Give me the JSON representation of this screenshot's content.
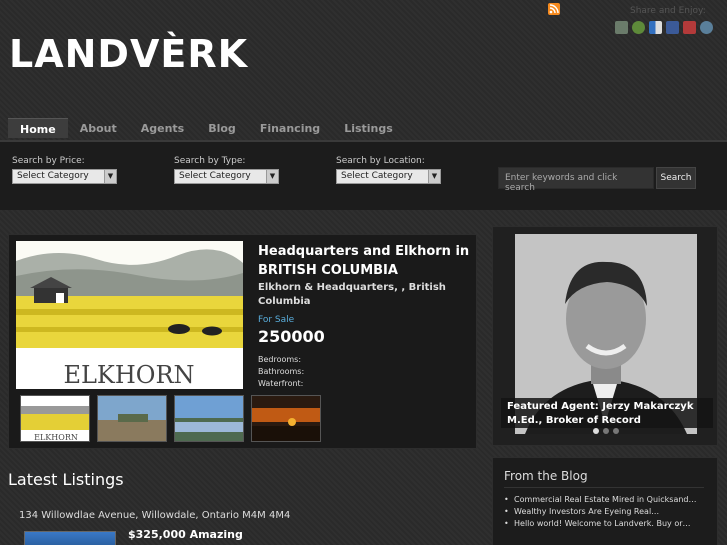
{
  "header": {
    "logo_text": "LANDVÈRK",
    "share_label": "Share and Enjoy:",
    "social_icons": [
      "digg-icon",
      "delicious-icon",
      "stumbleupon-icon",
      "facebook-icon",
      "mixx-icon",
      "google-icon"
    ],
    "rss_icon": "rss-icon"
  },
  "nav": {
    "items": [
      {
        "label": "Home",
        "active": true
      },
      {
        "label": "About"
      },
      {
        "label": "Agents"
      },
      {
        "label": "Blog"
      },
      {
        "label": "Financing"
      },
      {
        "label": "Listings"
      }
    ]
  },
  "search": {
    "price_label": "Search by Price:",
    "type_label": "Search by Type:",
    "location_label": "Search by Location:",
    "price_value": "Select Category",
    "type_value": "Select Category",
    "location_value": "Select Category",
    "keyword_placeholder": "Enter keywords and click search",
    "button_label": "Search"
  },
  "featured": {
    "title": "Headquarters and Elkhorn in BRITISH COLUMBIA",
    "address": "Elkhorn & Headquarters, , British Columbia",
    "status": "For Sale",
    "price": "250000",
    "bedrooms": "Bedrooms:",
    "bathrooms": "Bathrooms:",
    "waterfront": "Waterfront:",
    "image_caption": "ELKHORN",
    "thumb_caption": "ELKHORN"
  },
  "agent": {
    "caption_line1": "Featured Agent: Jerzy Makarczyk",
    "caption_line2": "M.Ed., Broker of Record"
  },
  "latest": {
    "heading": "Latest Listings",
    "items": [
      {
        "address": "134 Willowdlae Avenue, Willowdale, Ontario M4M 4M4",
        "price": "$325,000 Amazing"
      }
    ]
  },
  "blog": {
    "heading": "From the Blog",
    "posts": [
      "Commercial Real Estate Mired in Quicksand…",
      "Wealthy Investors Are Eyeing Real…",
      "Hello world! Welcome to Landverk. Buy or…"
    ]
  },
  "colors": {
    "accent_status": "#5aaedc",
    "rss": "#f68a1e"
  }
}
